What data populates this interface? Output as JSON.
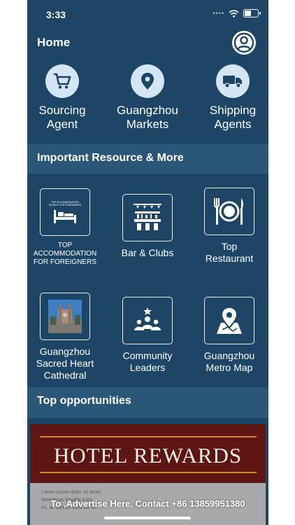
{
  "status": {
    "time": "3:33",
    "signal": "••••"
  },
  "header": {
    "title": "Home"
  },
  "top_categories": [
    {
      "label_1": "Sourcing",
      "label_2": "Agent",
      "icon": "shopping-cart-icon"
    },
    {
      "label_1": "Guangzhou",
      "label_2": "Markets",
      "icon": "location-pin-icon"
    },
    {
      "label_1": "Shipping",
      "label_2": "Agents",
      "icon": "truck-icon"
    }
  ],
  "sections": {
    "resources_title": "Important Resource & More",
    "opportunities_title": "Top opportunities"
  },
  "resources": [
    {
      "label_1": "TOP",
      "label_2": "ACCOMMODATION",
      "label_3": "FOR FOREIGNERS",
      "icon_text_1": "TOP ACCOMMODATION",
      "icon_text_2": "HOTELS FOR FOREIGNERS",
      "icon": "bed-icon"
    },
    {
      "label_1": "Bar & Clubs",
      "icon": "bar-counter-icon"
    },
    {
      "label_1": "Top",
      "label_2": "Restaurant",
      "icon": "plate-cutlery-icon"
    },
    {
      "label_1": "Guangzhou",
      "label_2": "Sacred Heart",
      "label_3": "Cathedral",
      "icon": "cathedral-photo"
    },
    {
      "label_1": "Community",
      "label_2": "Leaders",
      "icon": "group-star-icon"
    },
    {
      "label_1": "Guangzhou",
      "label_2": "Metro Map",
      "icon": "map-pin-icon"
    }
  ],
  "banner": {
    "title": "HOTEL REWARDS",
    "lorem_1": "Lorem ipsum dolor sit amet,",
    "lorem_2": "Maecenas fringilla justo.",
    "lorem_3": "ex, ac ultrices eros cur id.",
    "advert": "To ,Advertise Here, Contact +86 13859951380"
  },
  "colors": {
    "background": "#1d4565",
    "section_bar": "#2a5678",
    "icon_circle": "#d4e6f5",
    "banner": "#5e1612"
  }
}
